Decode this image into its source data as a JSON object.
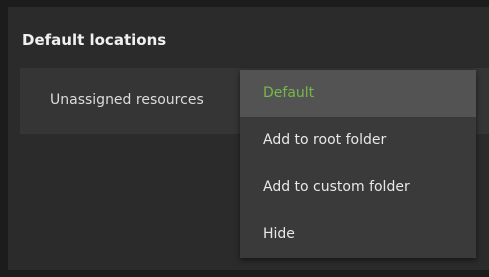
{
  "settings": {
    "section_title": "Default locations",
    "row": {
      "label": "Unassigned resources"
    }
  },
  "dropdown": {
    "selected_color": "#78b84a",
    "items": [
      {
        "label": "Default"
      },
      {
        "label": "Add to root folder"
      },
      {
        "label": "Add to custom folder"
      },
      {
        "label": "Hide"
      }
    ]
  }
}
